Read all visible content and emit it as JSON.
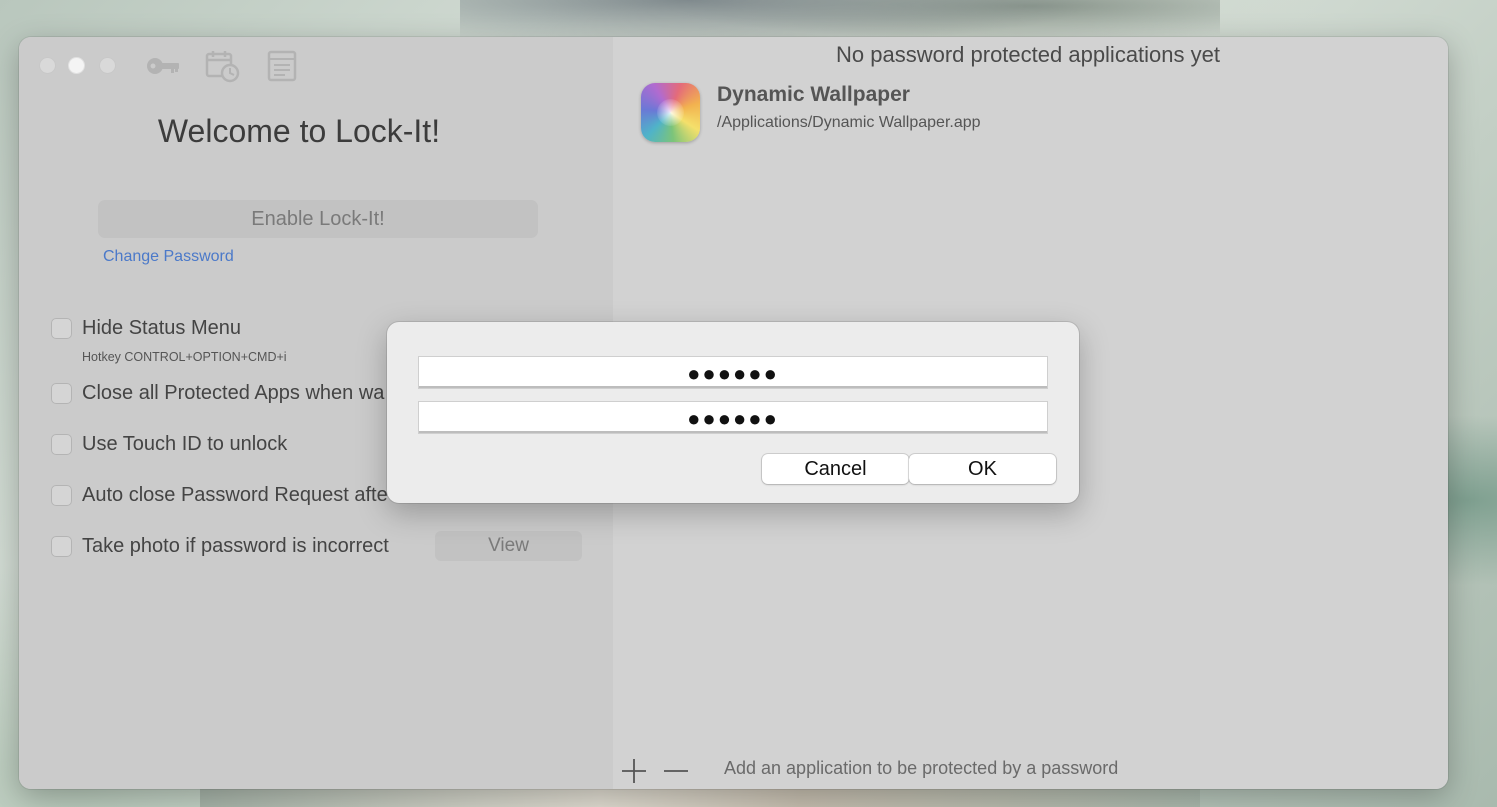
{
  "window": {
    "title": "Welcome to Lock-It!",
    "toolbar_icons": [
      "key-icon",
      "calendar-clock-icon",
      "document-icon"
    ]
  },
  "settings": {
    "enable_label": "Enable Lock-It!",
    "change_password_label": "Change Password",
    "options": [
      {
        "label": "Hide Status Menu",
        "checked": false
      },
      {
        "label": "Close all Protected Apps when wa",
        "checked": false
      },
      {
        "label": "Use Touch ID to unlock",
        "checked": false
      },
      {
        "label": "Auto close Password Request afte",
        "checked": false
      },
      {
        "label": "Take photo if password is incorrect",
        "checked": false
      }
    ],
    "hotkey_text": "Hotkey CONTROL+OPTION+CMD+i",
    "view_label": "View"
  },
  "apps_panel": {
    "header": "No password protected applications yet",
    "apps": [
      {
        "name": "Dynamic Wallpaper",
        "path": "/Applications/Dynamic Wallpaper.app",
        "icon": "dynamic-wallpaper-icon"
      }
    ],
    "footer_hint": "Add an application to be protected by a password"
  },
  "dialog": {
    "password_value": "●●●●●●",
    "confirm_value": "●●●●●●",
    "cancel_label": "Cancel",
    "ok_label": "OK"
  },
  "colors": {
    "link": "#4b79c9",
    "window_bg": "#cfcfcf",
    "dialog_bg": "#ececec"
  }
}
